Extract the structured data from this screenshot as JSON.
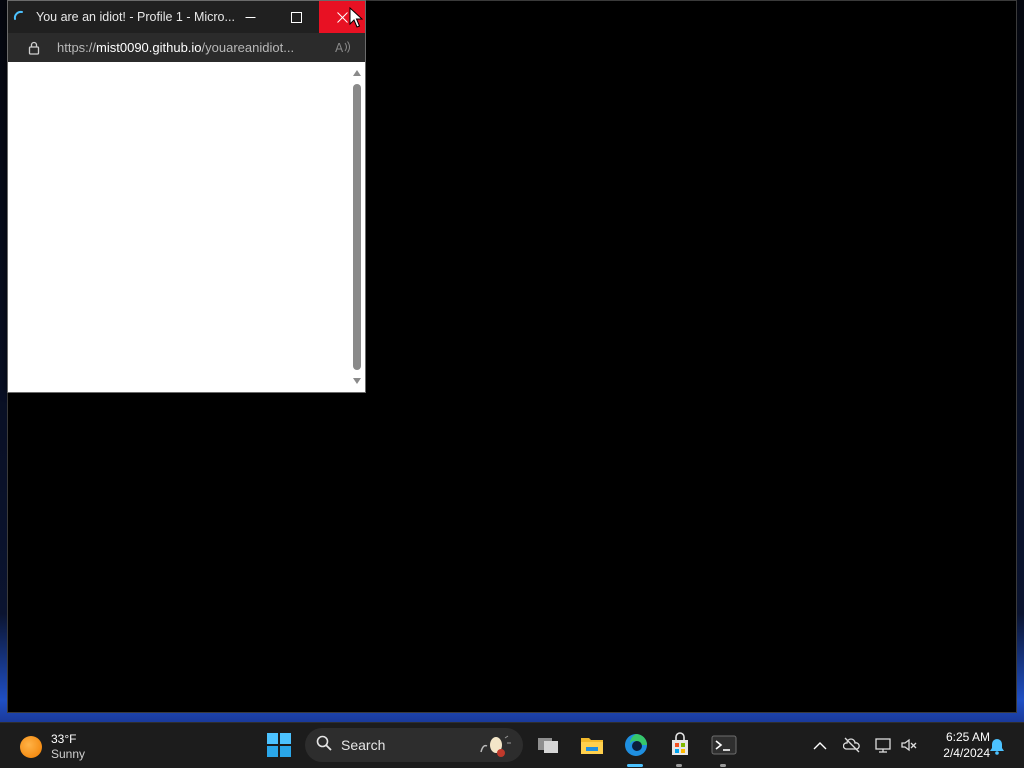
{
  "popup_window": {
    "title": "You are an idiot! - Profile 1 - Micro...",
    "url_scheme": "https://",
    "url_host": "mist0090.github.io",
    "url_path": "/youareanidiot..."
  },
  "taskbar": {
    "weather": {
      "temperature": "33°F",
      "condition": "Sunny"
    },
    "search_label": "Search",
    "clock": {
      "time": "6:25 AM",
      "date": "2/4/2024"
    },
    "apps": [
      "task-view",
      "file-explorer",
      "microsoft-edge",
      "microsoft-store",
      "terminal"
    ]
  },
  "colors": {
    "close_button": "#e81123",
    "titlebar": "#202020",
    "taskbar": "#1c1c1c",
    "accent": "#4cc2ff"
  }
}
